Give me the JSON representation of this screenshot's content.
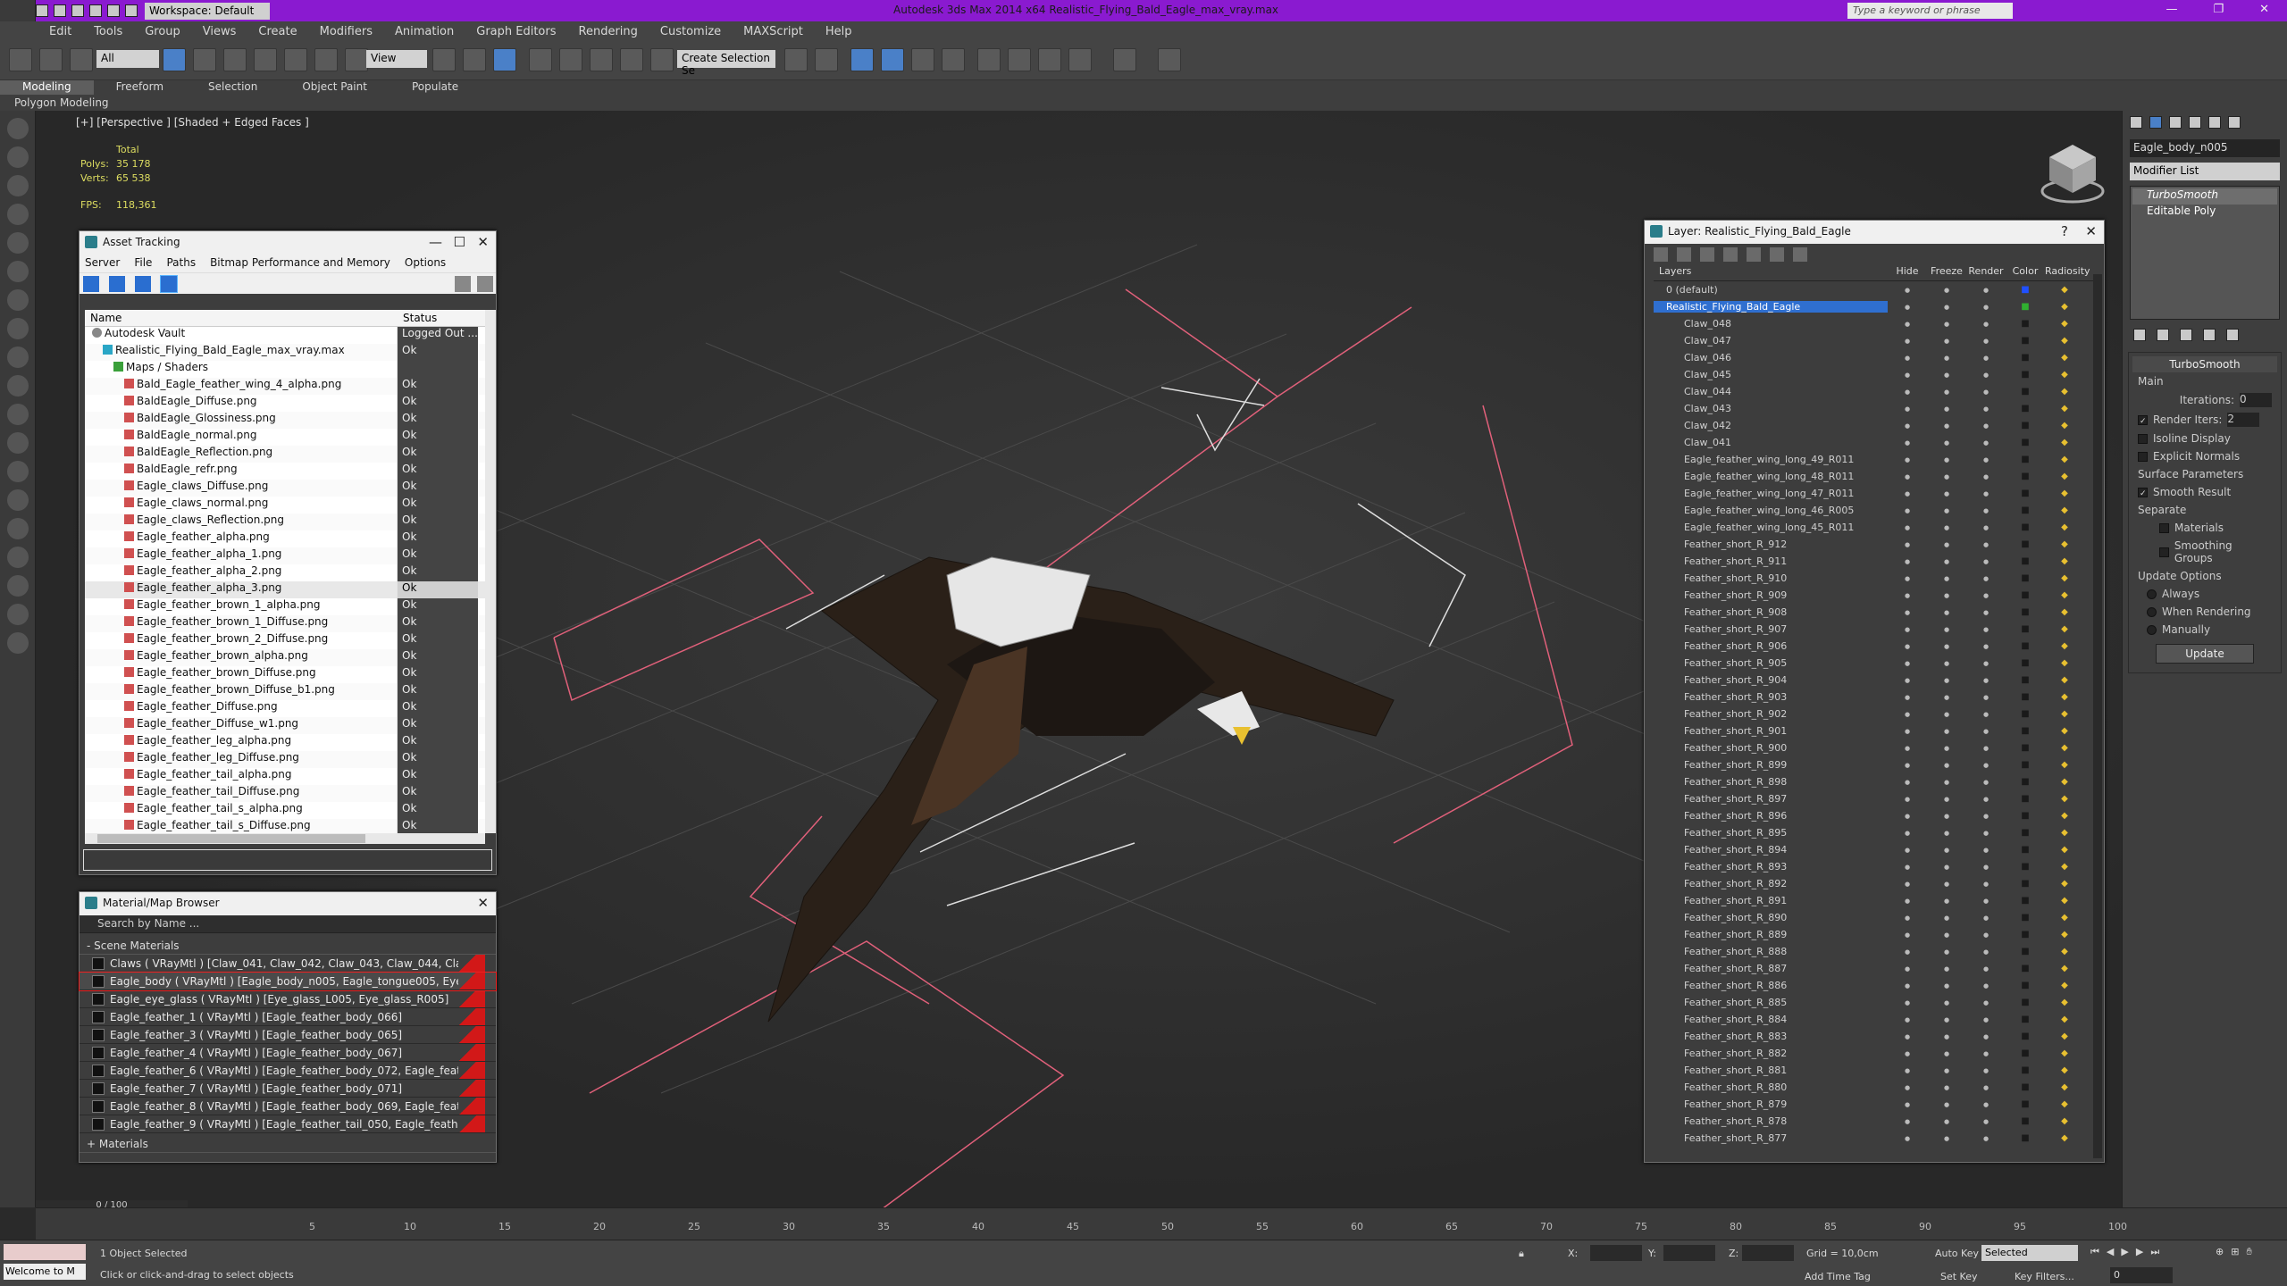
{
  "titlebar": {
    "workspace": "Workspace: Default",
    "app_title": "Autodesk 3ds Max  2014 x64     Realistic_Flying_Bald_Eagle_max_vray.max",
    "search_placeholder": "Type a keyword or phrase"
  },
  "menu": [
    "Edit",
    "Tools",
    "Group",
    "Views",
    "Create",
    "Modifiers",
    "Animation",
    "Graph Editors",
    "Rendering",
    "Customize",
    "MAXScript",
    "Help"
  ],
  "toolbar": {
    "filter": "All",
    "coord": "View",
    "named_selection": "Create Selection Se"
  },
  "ribbon": {
    "tabs": [
      "Modeling",
      "Freeform",
      "Selection",
      "Object Paint",
      "Populate"
    ],
    "sub": "Polygon Modeling"
  },
  "viewport": {
    "label": "[+] [Perspective ] [Shaded + Edged Faces ]",
    "stats": {
      "total": "Total",
      "polys_label": "Polys:",
      "polys": "35 178",
      "verts_label": "Verts:",
      "verts": "65 538",
      "fps_label": "FPS:",
      "fps": "118,361"
    }
  },
  "asset_tracking": {
    "title": "Asset Tracking",
    "menu": [
      "Server",
      "File",
      "Paths",
      "Bitmap Performance and Memory",
      "Options"
    ],
    "col_name": "Name",
    "col_status": "Status",
    "rows": [
      {
        "name": "Autodesk Vault",
        "status": "Logged Out ...",
        "level": 1,
        "type": "vault"
      },
      {
        "name": "Realistic_Flying_Bald_Eagle_max_vray.max",
        "status": "Ok",
        "level": 2,
        "type": "file"
      },
      {
        "name": "Maps / Shaders",
        "status": "",
        "level": 3,
        "type": "map"
      },
      {
        "name": "Bald_Eagle_feather_wing_4_alpha.png",
        "status": "Ok",
        "level": 4,
        "type": "png"
      },
      {
        "name": "BaldEagle_Diffuse.png",
        "status": "Ok",
        "level": 4,
        "type": "png"
      },
      {
        "name": "BaldEagle_Glossiness.png",
        "status": "Ok",
        "level": 4,
        "type": "png"
      },
      {
        "name": "BaldEagle_normal.png",
        "status": "Ok",
        "level": 4,
        "type": "png"
      },
      {
        "name": "BaldEagle_Reflection.png",
        "status": "Ok",
        "level": 4,
        "type": "png"
      },
      {
        "name": "BaldEagle_refr.png",
        "status": "Ok",
        "level": 4,
        "type": "png"
      },
      {
        "name": "Eagle_claws_Diffuse.png",
        "status": "Ok",
        "level": 4,
        "type": "png"
      },
      {
        "name": "Eagle_claws_normal.png",
        "status": "Ok",
        "level": 4,
        "type": "png"
      },
      {
        "name": "Eagle_claws_Reflection.png",
        "status": "Ok",
        "level": 4,
        "type": "png"
      },
      {
        "name": "Eagle_feather_alpha.png",
        "status": "Ok",
        "level": 4,
        "type": "png"
      },
      {
        "name": "Eagle_feather_alpha_1.png",
        "status": "Ok",
        "level": 4,
        "type": "png"
      },
      {
        "name": "Eagle_feather_alpha_2.png",
        "status": "Ok",
        "level": 4,
        "type": "png"
      },
      {
        "name": "Eagle_feather_alpha_3.png",
        "status": "Ok",
        "level": 4,
        "type": "png",
        "selected": true
      },
      {
        "name": "Eagle_feather_brown_1_alpha.png",
        "status": "Ok",
        "level": 4,
        "type": "png"
      },
      {
        "name": "Eagle_feather_brown_1_Diffuse.png",
        "status": "Ok",
        "level": 4,
        "type": "png"
      },
      {
        "name": "Eagle_feather_brown_2_Diffuse.png",
        "status": "Ok",
        "level": 4,
        "type": "png"
      },
      {
        "name": "Eagle_feather_brown_alpha.png",
        "status": "Ok",
        "level": 4,
        "type": "png"
      },
      {
        "name": "Eagle_feather_brown_Diffuse.png",
        "status": "Ok",
        "level": 4,
        "type": "png"
      },
      {
        "name": "Eagle_feather_brown_Diffuse_b1.png",
        "status": "Ok",
        "level": 4,
        "type": "png"
      },
      {
        "name": "Eagle_feather_Diffuse.png",
        "status": "Ok",
        "level": 4,
        "type": "png"
      },
      {
        "name": "Eagle_feather_Diffuse_w1.png",
        "status": "Ok",
        "level": 4,
        "type": "png"
      },
      {
        "name": "Eagle_feather_leg_alpha.png",
        "status": "Ok",
        "level": 4,
        "type": "png"
      },
      {
        "name": "Eagle_feather_leg_Diffuse.png",
        "status": "Ok",
        "level": 4,
        "type": "png"
      },
      {
        "name": "Eagle_feather_tail_alpha.png",
        "status": "Ok",
        "level": 4,
        "type": "png"
      },
      {
        "name": "Eagle_feather_tail_Diffuse.png",
        "status": "Ok",
        "level": 4,
        "type": "png"
      },
      {
        "name": "Eagle_feather_tail_s_alpha.png",
        "status": "Ok",
        "level": 4,
        "type": "png"
      },
      {
        "name": "Eagle_feather_tail_s_Diffuse.png",
        "status": "Ok",
        "level": 4,
        "type": "png"
      }
    ]
  },
  "material_browser": {
    "title": "Material/Map Browser",
    "search_placeholder": "Search by Name ...",
    "group_scene": "- Scene Materials",
    "group_materials": "+ Materials",
    "items": [
      "Claws  ( VRayMtl )  [Claw_041, Claw_042, Claw_043, Claw_044, Claw_045, Cla...",
      "Eagle_body  ( VRayMtl )  [Eagle_body_n005, Eagle_tongue005, Eye_L005, Eye...",
      "Eagle_eye_glass  ( VRayMtl )  [Eye_glass_L005, Eye_glass_R005]",
      "Eagle_feather_1  ( VRayMtl )  [Eagle_feather_body_066]",
      "Eagle_feather_3  ( VRayMtl )  [Eagle_feather_body_065]",
      "Eagle_feather_4  ( VRayMtl )  [Eagle_feather_body_067]",
      "Eagle_feather_6  ( VRayMtl )  [Eagle_feather_body_072, Eagle_feather_body...",
      "Eagle_feather_7  ( VRayMtl )  [Eagle_feather_body_071]",
      "Eagle_feather_8  ( VRayMtl )  [Eagle_feather_body_069, Eagle_feather_body...",
      "Eagle_feather_9  ( VRayMtl )  [Eagle_feather_tail_050, Eagle_feather_tail_051,..."
    ]
  },
  "layers": {
    "title": "Layer: Realistic_Flying_Bald_Eagle",
    "columns": [
      "Layers",
      "Hide",
      "Freeze",
      "Render",
      "Color",
      "Radiosity"
    ],
    "rows": [
      "0 (default)",
      "Realistic_Flying_Bald_Eagle",
      "Claw_048",
      "Claw_047",
      "Claw_046",
      "Claw_045",
      "Claw_044",
      "Claw_043",
      "Claw_042",
      "Claw_041",
      "Eagle_feather_wing_long_49_R011",
      "Eagle_feather_wing_long_48_R011",
      "Eagle_feather_wing_long_47_R011",
      "Eagle_feather_wing_long_46_R005",
      "Eagle_feather_wing_long_45_R011",
      "Feather_short_R_912",
      "Feather_short_R_911",
      "Feather_short_R_910",
      "Feather_short_R_909",
      "Feather_short_R_908",
      "Feather_short_R_907",
      "Feather_short_R_906",
      "Feather_short_R_905",
      "Feather_short_R_904",
      "Feather_short_R_903",
      "Feather_short_R_902",
      "Feather_short_R_901",
      "Feather_short_R_900",
      "Feather_short_R_899",
      "Feather_short_R_898",
      "Feather_short_R_897",
      "Feather_short_R_896",
      "Feather_short_R_895",
      "Feather_short_R_894",
      "Feather_short_R_893",
      "Feather_short_R_892",
      "Feather_short_R_891",
      "Feather_short_R_890",
      "Feather_short_R_889",
      "Feather_short_R_888",
      "Feather_short_R_887",
      "Feather_short_R_886",
      "Feather_short_R_885",
      "Feather_short_R_884",
      "Feather_short_R_883",
      "Feather_short_R_882",
      "Feather_short_R_881",
      "Feather_short_R_880",
      "Feather_short_R_879",
      "Feather_short_R_878",
      "Feather_short_R_877"
    ]
  },
  "command_panel": {
    "object_name": "Eagle_body_n005",
    "modifier_list": "Modifier List",
    "stack": [
      "TurboSmooth",
      "Editable Poly"
    ],
    "turbosmooth": "TurboSmooth",
    "main": "Main",
    "iterations_label": "Iterations:",
    "iterations": "0",
    "render_iters_label": "Render Iters:",
    "render_iters": "2",
    "isoline": "Isoline Display",
    "explicit": "Explicit Normals",
    "surface": "Surface Parameters",
    "smooth_result": "Smooth Result",
    "separate": "Separate",
    "materials": "Materials",
    "smoothing_groups": "Smoothing Groups",
    "update_options": "Update Options",
    "always": "Always",
    "when_rendering": "When Rendering",
    "manually": "Manually",
    "update_btn": "Update"
  },
  "timeline": {
    "frame": "0 / 100",
    "ticks": [
      "5",
      "10",
      "15",
      "20",
      "25",
      "30",
      "35",
      "40",
      "45",
      "50",
      "55",
      "60",
      "65",
      "70",
      "75",
      "80",
      "85",
      "90",
      "95",
      "100"
    ]
  },
  "status": {
    "maxscript": "Welcome to M",
    "selected": "1 Object Selected",
    "prompt": "Click or click-and-drag to select objects",
    "x_label": "X:",
    "y_label": "Y:",
    "z_label": "Z:",
    "grid": "Grid = 10,0cm",
    "auto_key": "Auto Key",
    "selected_dropdown": "Selected",
    "set_key": "Set Key",
    "key_filters": "Key Filters...",
    "add_time_tag": "Add Time Tag",
    "frame_value": "0"
  },
  "colors": {
    "titlebar": "#8a1ad0",
    "accent_blue": "#2f6fd0",
    "wire_pink": "#e0607a"
  }
}
